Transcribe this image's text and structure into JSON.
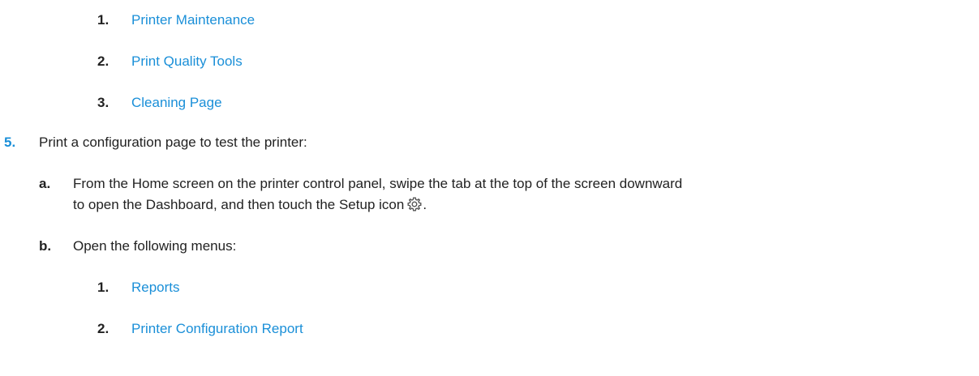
{
  "nested_list_top": {
    "items": [
      {
        "marker": "1.",
        "label": "Printer Maintenance"
      },
      {
        "marker": "2.",
        "label": "Print Quality Tools"
      },
      {
        "marker": "3.",
        "label": "Cleaning Page"
      }
    ]
  },
  "step5": {
    "marker": "5.",
    "text": "Print a configuration page to test the printer:",
    "substeps": {
      "a": {
        "marker": "a.",
        "line1": "From the Home screen on the printer control panel, swipe the tab at the top of the screen downward",
        "line2": "to open the Dashboard, and then touch the Setup icon",
        "line2_end": ".",
        "icon": "gear-icon"
      },
      "b": {
        "marker": "b.",
        "text": "Open the following menus:",
        "items": [
          {
            "marker": "1.",
            "label": "Reports"
          },
          {
            "marker": "2.",
            "label": "Printer Configuration Report"
          }
        ]
      }
    }
  },
  "colors": {
    "link": "#1a8fd8",
    "text": "#222222"
  }
}
